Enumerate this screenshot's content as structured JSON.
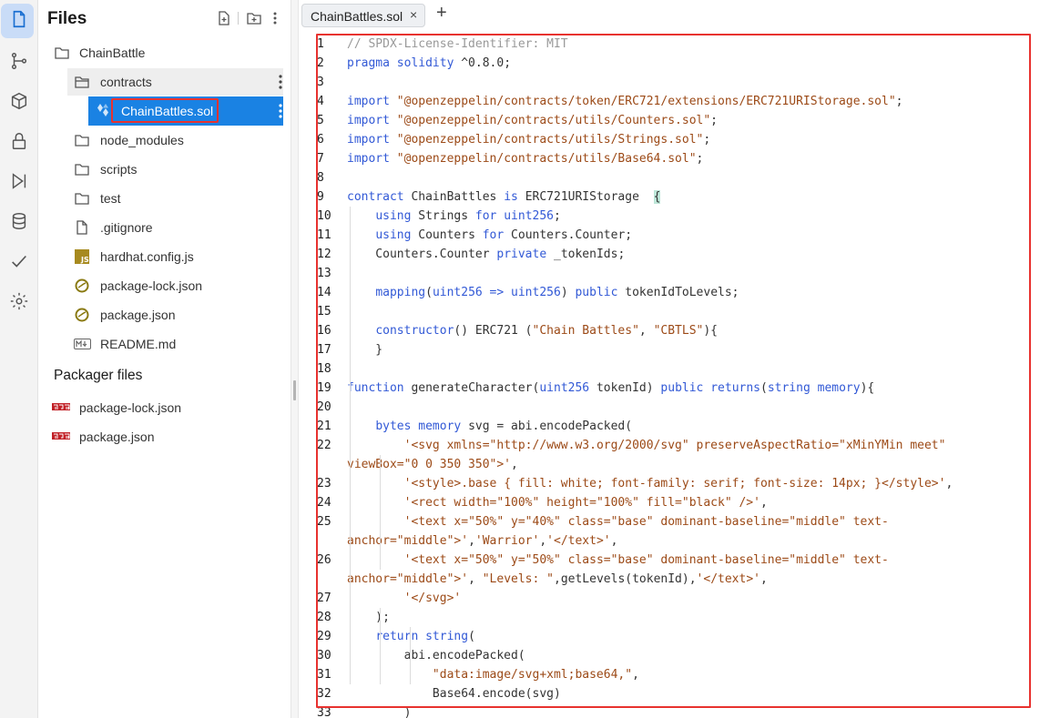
{
  "sidebar": {
    "title": "Files",
    "tree": [
      {
        "label": "ChainBattle",
        "icon": "folder-icon"
      },
      {
        "label": "contracts",
        "icon": "folder-open-icon"
      },
      {
        "label": "ChainBattles.sol",
        "icon": "solidity-icon"
      },
      {
        "label": "node_modules",
        "icon": "folder-icon"
      },
      {
        "label": "scripts",
        "icon": "folder-icon"
      },
      {
        "label": "test",
        "icon": "folder-icon"
      },
      {
        "label": ".gitignore",
        "icon": "file-icon"
      },
      {
        "label": "hardhat.config.js",
        "icon": "js-file-icon"
      },
      {
        "label": "package-lock.json",
        "icon": "yarn-icon"
      },
      {
        "label": "package.json",
        "icon": "yarn-icon"
      },
      {
        "label": "README.md",
        "icon": "markdown-icon"
      }
    ],
    "packager_title": "Packager files",
    "packager_items": [
      {
        "label": "package-lock.json",
        "icon": "npm-icon"
      },
      {
        "label": "package.json",
        "icon": "npm-icon"
      }
    ]
  },
  "tab": {
    "label": "ChainBattles.sol",
    "close": "×",
    "add": "+"
  },
  "colors": {
    "accent": "#1a82e3",
    "highlight_box": "#e8322f",
    "keyword": "#3259d6",
    "string": "#9c4a17",
    "comment": "#999999"
  },
  "code": [
    {
      "n": "1",
      "t": [
        [
          "cm",
          "// SPDX-License-Identifier: MIT"
        ]
      ]
    },
    {
      "n": "2",
      "t": [
        [
          "kw",
          "pragma solidity "
        ],
        [
          "",
          "^0.8.0;"
        ]
      ]
    },
    {
      "n": "3",
      "t": []
    },
    {
      "n": "4",
      "t": [
        [
          "kw",
          "import "
        ],
        [
          "str",
          "\"@openzeppelin/contracts/token/ERC721/extensions/ERC721URIStorage.sol\""
        ],
        [
          "",
          ";"
        ]
      ]
    },
    {
      "n": "5",
      "t": [
        [
          "kw",
          "import "
        ],
        [
          "str",
          "\"@openzeppelin/contracts/utils/Counters.sol\""
        ],
        [
          "",
          ";"
        ]
      ]
    },
    {
      "n": "6",
      "t": [
        [
          "kw",
          "import "
        ],
        [
          "str",
          "\"@openzeppelin/contracts/utils/Strings.sol\""
        ],
        [
          "",
          ";"
        ]
      ]
    },
    {
      "n": "7",
      "t": [
        [
          "kw",
          "import "
        ],
        [
          "str",
          "\"@openzeppelin/contracts/utils/Base64.sol\""
        ],
        [
          "",
          ";"
        ]
      ]
    },
    {
      "n": "8",
      "t": []
    },
    {
      "n": "9",
      "t": [
        [
          "kw",
          "contract "
        ],
        [
          "",
          "ChainBattles "
        ],
        [
          "kw",
          "is "
        ],
        [
          "",
          "ERC721URIStorage  "
        ],
        [
          "brace",
          "{"
        ]
      ]
    },
    {
      "n": "10",
      "t": [
        [
          "",
          "    "
        ],
        [
          "kw",
          "using "
        ],
        [
          "",
          "Strings "
        ],
        [
          "kw",
          "for "
        ],
        [
          "ty",
          "uint256"
        ],
        [
          "",
          ";"
        ]
      ]
    },
    {
      "n": "11",
      "t": [
        [
          "",
          "    "
        ],
        [
          "kw",
          "using "
        ],
        [
          "",
          "Counters "
        ],
        [
          "kw",
          "for "
        ],
        [
          "",
          "Counters.Counter;"
        ]
      ]
    },
    {
      "n": "12",
      "t": [
        [
          "",
          "    Counters.Counter "
        ],
        [
          "kw",
          "private "
        ],
        [
          "",
          "_tokenIds;"
        ]
      ]
    },
    {
      "n": "13",
      "t": []
    },
    {
      "n": "14",
      "t": [
        [
          "",
          "    "
        ],
        [
          "kw",
          "mapping"
        ],
        [
          "",
          "("
        ],
        [
          "ty",
          "uint256 => uint256"
        ],
        [
          "",
          ") "
        ],
        [
          "kw",
          "public "
        ],
        [
          "",
          "tokenIdToLevels;"
        ]
      ]
    },
    {
      "n": "15",
      "t": []
    },
    {
      "n": "16",
      "t": [
        [
          "",
          "    "
        ],
        [
          "kw",
          "constructor"
        ],
        [
          "",
          "() ERC721 ("
        ],
        [
          "str",
          "\"Chain Battles\""
        ],
        [
          "",
          ", "
        ],
        [
          "str",
          "\"CBTLS\""
        ],
        [
          "",
          "){"
        ]
      ]
    },
    {
      "n": "17",
      "t": [
        [
          "",
          "    }"
        ]
      ]
    },
    {
      "n": "18",
      "t": []
    },
    {
      "n": "19",
      "t": [
        [
          "kw",
          "function "
        ],
        [
          "",
          "generateCharacter("
        ],
        [
          "ty",
          "uint256 "
        ],
        [
          "",
          "tokenId) "
        ],
        [
          "kw",
          "public returns"
        ],
        [
          "",
          "("
        ],
        [
          "kw",
          "string memory"
        ],
        [
          "",
          "){"
        ]
      ]
    },
    {
      "n": "20",
      "t": []
    },
    {
      "n": "21",
      "t": [
        [
          "",
          "    "
        ],
        [
          "kw",
          "bytes memory "
        ],
        [
          "",
          "svg = abi.encodePacked("
        ]
      ]
    },
    {
      "n": "22",
      "t": [
        [
          "",
          "        "
        ],
        [
          "str",
          "'<svg xmlns=\"http://www.w3.org/2000/svg\" preserveAspectRatio=\"xMinYMin meet\""
        ]
      ]
    },
    {
      "n": "",
      "t": [
        [
          "str",
          "viewBox=\"0 0 350 350\">'"
        ],
        [
          "",
          ","
        ]
      ]
    },
    {
      "n": "23",
      "t": [
        [
          "",
          "        "
        ],
        [
          "str",
          "'<style>.base { fill: white; font-family: serif; font-size: 14px; }</style>'"
        ],
        [
          "",
          ","
        ]
      ]
    },
    {
      "n": "24",
      "t": [
        [
          "",
          "        "
        ],
        [
          "str",
          "'<rect width=\"100%\" height=\"100%\" fill=\"black\" />'"
        ],
        [
          "",
          ","
        ]
      ]
    },
    {
      "n": "25",
      "t": [
        [
          "",
          "        "
        ],
        [
          "str",
          "'<text x=\"50%\" y=\"40%\" class=\"base\" dominant-baseline=\"middle\" text-"
        ]
      ]
    },
    {
      "n": "",
      "t": [
        [
          "str",
          "anchor=\"middle\">'"
        ],
        [
          "",
          ","
        ],
        [
          "str",
          "'Warrior'"
        ],
        [
          "",
          ","
        ],
        [
          "str",
          "'</text>'"
        ],
        [
          "",
          ","
        ]
      ]
    },
    {
      "n": "26",
      "t": [
        [
          "",
          "        "
        ],
        [
          "str",
          "'<text x=\"50%\" y=\"50%\" class=\"base\" dominant-baseline=\"middle\" text-"
        ]
      ]
    },
    {
      "n": "",
      "t": [
        [
          "str",
          "anchor=\"middle\">'"
        ],
        [
          "",
          ", "
        ],
        [
          "str",
          "\"Levels: \""
        ],
        [
          "",
          ",getLevels(tokenId),"
        ],
        [
          "str",
          "'</text>'"
        ],
        [
          "",
          ","
        ]
      ]
    },
    {
      "n": "27",
      "t": [
        [
          "",
          "        "
        ],
        [
          "str",
          "'</svg>'"
        ]
      ]
    },
    {
      "n": "28",
      "t": [
        [
          "",
          "    );"
        ]
      ]
    },
    {
      "n": "29",
      "t": [
        [
          "",
          "    "
        ],
        [
          "kw",
          "return string"
        ],
        [
          "",
          "("
        ]
      ]
    },
    {
      "n": "30",
      "t": [
        [
          "",
          "        abi.encodePacked("
        ]
      ]
    },
    {
      "n": "31",
      "t": [
        [
          "",
          "            "
        ],
        [
          "str",
          "\"data:image/svg+xml;base64,\""
        ],
        [
          "",
          ","
        ]
      ]
    },
    {
      "n": "32",
      "t": [
        [
          "",
          "            Base64.encode(svg)"
        ]
      ]
    },
    {
      "n": "33",
      "t": [
        [
          "",
          "        )"
        ]
      ]
    }
  ]
}
